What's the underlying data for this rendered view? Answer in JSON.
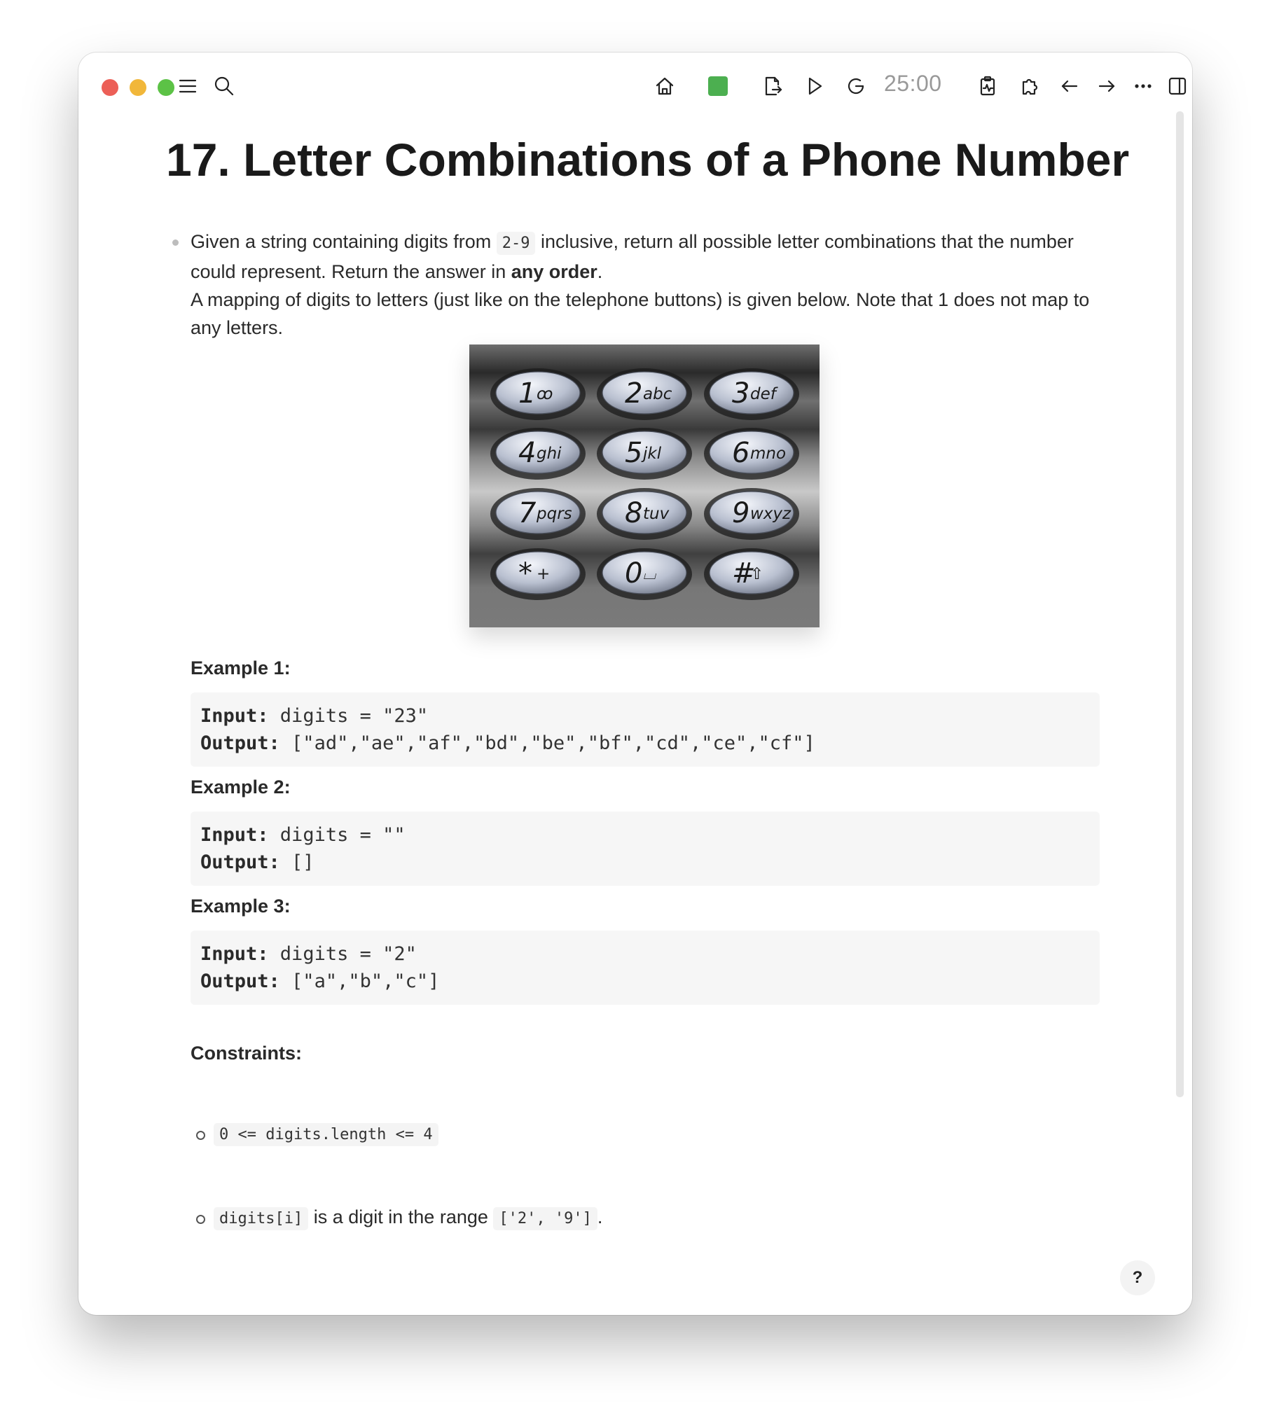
{
  "toolbar": {
    "timer": "25:00",
    "status_color": "#4caf50"
  },
  "page": {
    "title": "17. Letter Combinations of a Phone Number",
    "desc1_pre": "Given a string containing digits from ",
    "desc1_code": "2-9",
    "desc1_post": " inclusive, return all possible letter combinations that the number could represent. Return the answer in ",
    "desc1_bold": "any order",
    "desc1_end": ".",
    "desc2": "A mapping of digits to letters (just like on the telephone buttons) is given below. Note that 1 does not map to any letters."
  },
  "keypad": {
    "keys": [
      {
        "digit": "1",
        "letters": "ꝏ"
      },
      {
        "digit": "2",
        "letters": "abc"
      },
      {
        "digit": "3",
        "letters": "def"
      },
      {
        "digit": "4",
        "letters": "ghi"
      },
      {
        "digit": "5",
        "letters": "jkl"
      },
      {
        "digit": "6",
        "letters": "mno"
      },
      {
        "digit": "7",
        "letters": "pqrs"
      },
      {
        "digit": "8",
        "letters": "tuv"
      },
      {
        "digit": "9",
        "letters": "wxyz"
      },
      {
        "digit": "*",
        "letters": "+"
      },
      {
        "digit": "0",
        "letters": "⌴"
      },
      {
        "digit": "#",
        "letters": "⇧"
      }
    ]
  },
  "examples": [
    {
      "label": "Example 1:",
      "input_label": "Input:",
      "input": " digits = \"23\"",
      "output_label": "Output:",
      "output": " [\"ad\",\"ae\",\"af\",\"bd\",\"be\",\"bf\",\"cd\",\"ce\",\"cf\"]"
    },
    {
      "label": "Example 2:",
      "input_label": "Input:",
      "input": " digits = \"\"",
      "output_label": "Output:",
      "output": " []"
    },
    {
      "label": "Example 3:",
      "input_label": "Input:",
      "input": " digits = \"2\"",
      "output_label": "Output:",
      "output": " [\"a\",\"b\",\"c\"]"
    }
  ],
  "constraints": {
    "label": "Constraints:",
    "c1_code": "0 <= digits.length <= 4",
    "c2_code": "digits[i]",
    "c2_text": " is a digit in the range ",
    "c2_code2": "['2', '9']",
    "c2_end": "."
  },
  "help": "?"
}
